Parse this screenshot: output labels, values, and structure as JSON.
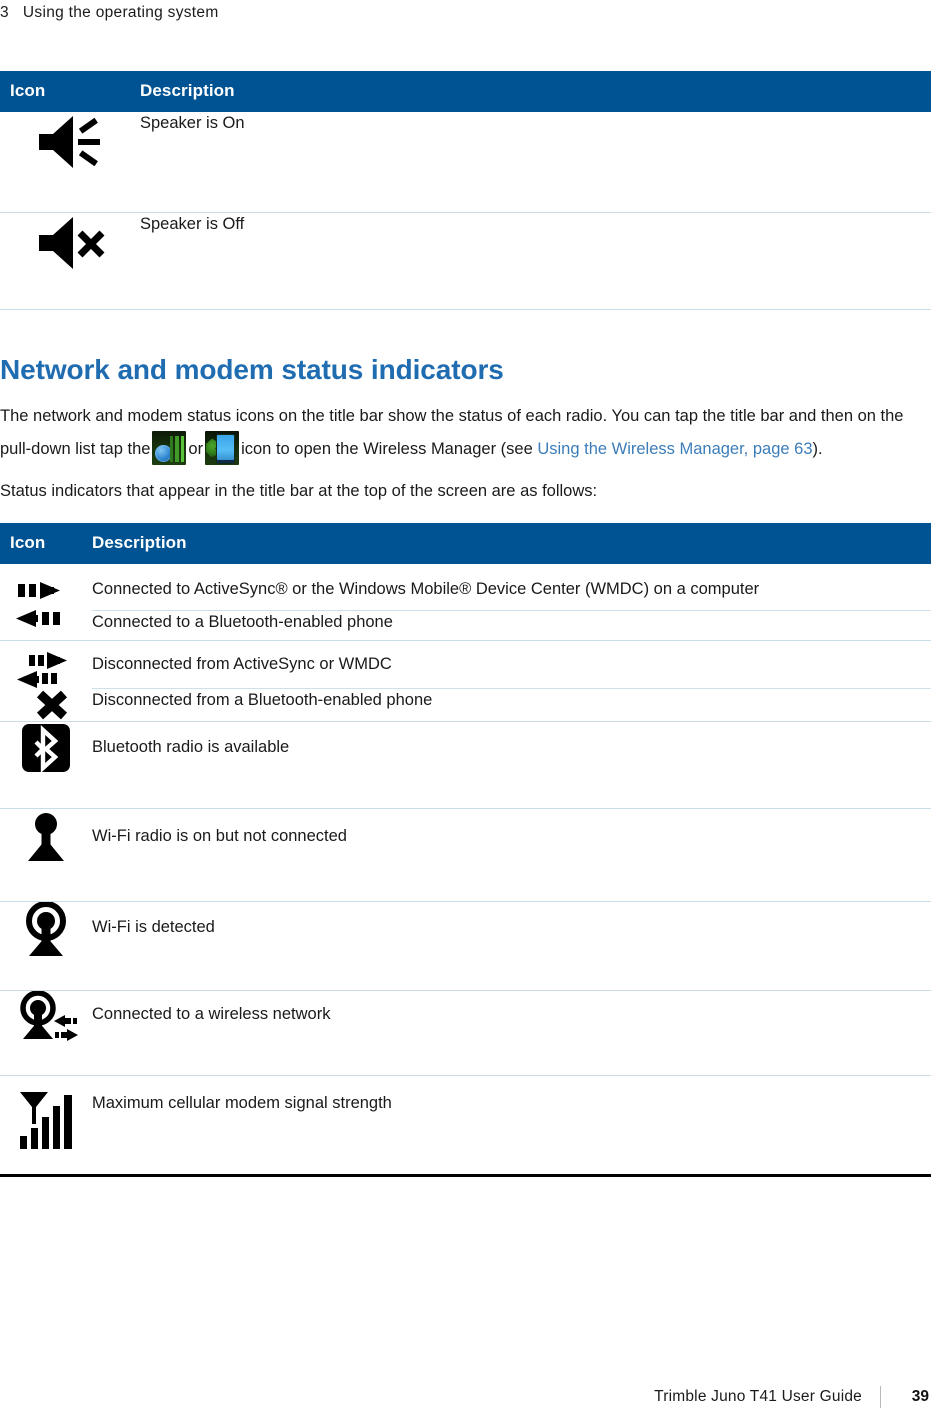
{
  "running_header": {
    "chapter_number": "3",
    "chapter_title": "Using the  operating system"
  },
  "speaker_table": {
    "columns": [
      "Icon",
      "Description"
    ],
    "rows": [
      {
        "icon": "speaker-on-icon",
        "description": "Speaker is On"
      },
      {
        "icon": "speaker-off-icon",
        "description": "Speaker is Off"
      }
    ]
  },
  "section": {
    "heading": "Network and modem status indicators",
    "heading_color": "#1f6cb0",
    "paragraph_1_part_1": "The network and modem status icons on the title bar show the status of each radio. You can tap the title bar and then on the pull-down list tap the",
    "paragraph_1_or": "or",
    "paragraph_1_part_2": "icon to open the Wireless Manager (see",
    "link_text": "Using the Wireless Manager, page 63",
    "paragraph_1_tail": ").",
    "paragraph_2": "Status indicators that appear in the title bar at the top of the screen are as follows:",
    "inline_icon_1": "phone-signal-icon",
    "inline_icon_2": "mobile-device-icon",
    "link_color": "#3c7db8"
  },
  "status_table": {
    "columns": [
      "Icon",
      "Description"
    ],
    "header_bg": "#005392",
    "rows": [
      {
        "icon": "activesync-connected-icon",
        "descriptions": [
          "Connected to ActiveSync® or the Windows Mobile® Device Center (WMDC) on a computer",
          "Connected to a Bluetooth-enabled phone"
        ]
      },
      {
        "icon": "activesync-disconnected-icon",
        "descriptions": [
          "Disconnected from ActiveSync or WMDC",
          "Disconnected from a Bluetooth-enabled phone"
        ]
      },
      {
        "icon": "bluetooth-icon",
        "descriptions": [
          "Bluetooth radio is available"
        ]
      },
      {
        "icon": "wifi-on-icon",
        "descriptions": [
          "Wi-Fi radio is on but not connected"
        ]
      },
      {
        "icon": "wifi-detected-icon",
        "descriptions": [
          "Wi-Fi is detected"
        ]
      },
      {
        "icon": "wifi-connected-icon",
        "descriptions": [
          "Connected to a wireless network"
        ]
      },
      {
        "icon": "cellular-signal-icon",
        "descriptions": [
          "Maximum cellular modem signal strength"
        ]
      }
    ]
  },
  "footer": {
    "title": "Trimble Juno T41 User Guide",
    "page_number": "39"
  }
}
